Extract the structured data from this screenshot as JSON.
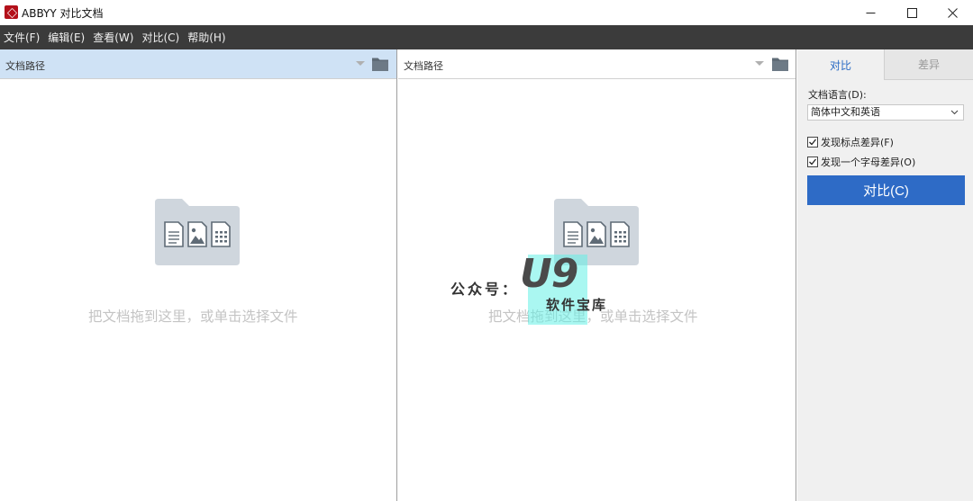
{
  "window": {
    "title": "ABBYY 对比文档",
    "logo_icon": "abbyy-logo-icon",
    "minimize_icon": "minimize-icon",
    "maximize_icon": "maximize-icon",
    "close_icon": "close-icon"
  },
  "menu": {
    "items": [
      "文件(F)",
      "编辑(E)",
      "查看(W)",
      "对比(C)",
      "帮助(H)"
    ]
  },
  "left_pane": {
    "path_placeholder": "文档路径",
    "drop_text": "把文档拖到这里，或单击选择文件",
    "folder_icon": "folder-icon",
    "drop_icon": "documents-folder-icon",
    "selected": true
  },
  "right_pane": {
    "path_placeholder": "文档路径",
    "drop_text": "把文档拖到这里，或单击选择文件",
    "folder_icon": "folder-icon",
    "drop_icon": "documents-folder-icon",
    "selected": false
  },
  "side_panel": {
    "tabs": [
      {
        "label": "对比",
        "active": true
      },
      {
        "label": "差异",
        "active": false
      }
    ],
    "language_label": "文档语言(D):",
    "language_value": "简体中文和英语",
    "options": [
      {
        "label": "发现标点差异(F)",
        "checked": true
      },
      {
        "label": "发现一个字母差异(O)",
        "checked": true
      }
    ],
    "compare_button": "对比(C)"
  },
  "watermark": {
    "prefix": "公众号：",
    "logo": "U9",
    "subtitle": "软件宝库"
  },
  "colors": {
    "menubar_bg": "#3b3b3b",
    "selected_path_bg": "#cfe2f5",
    "accent": "#2e6bc6",
    "drop_text": "#c4c4c4",
    "icon_fill": "#cfd6dd",
    "icon_glyph": "#5f6b76"
  }
}
